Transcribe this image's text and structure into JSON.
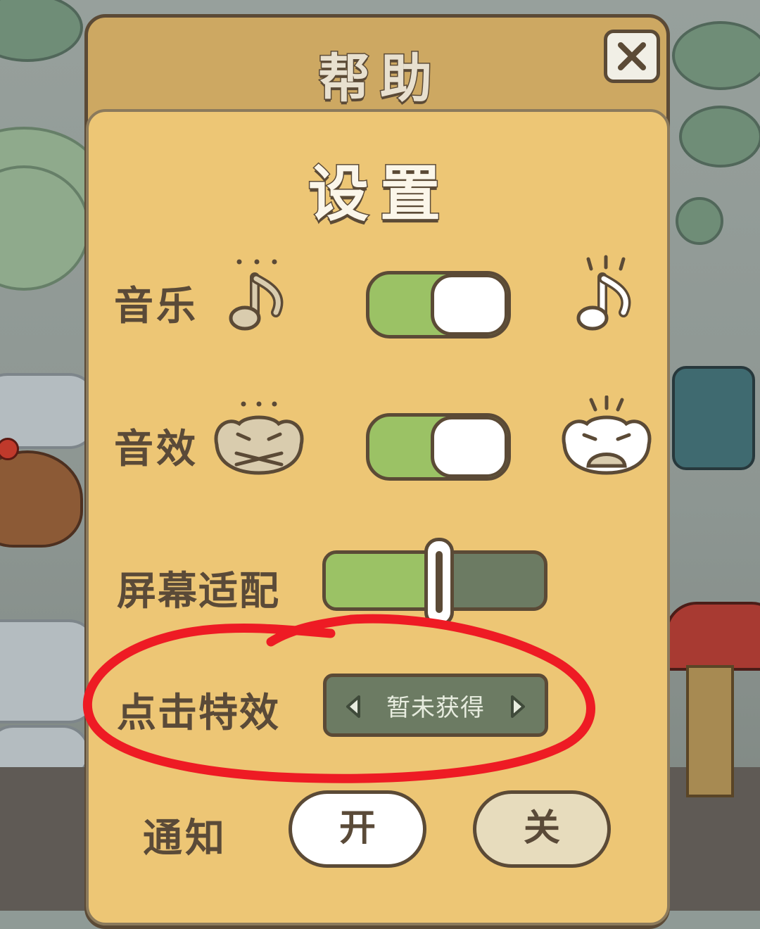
{
  "dialog": {
    "header_title": "帮助",
    "close_icon": "close-icon",
    "section_title": "设置"
  },
  "settings": {
    "music": {
      "label": "音乐",
      "icon_left": "music-note-muted-icon",
      "icon_right": "music-note-loud-icon",
      "enabled": true
    },
    "sound_effects": {
      "label": "音效",
      "icon_left": "frog-muted-icon",
      "icon_right": "frog-loud-icon",
      "enabled": true
    },
    "screen_fit": {
      "label": "屏幕适配",
      "level": 0.52
    },
    "tap_effect": {
      "label": "点击特效",
      "value": "暂未获得",
      "prev_icon": "arrow-left-icon",
      "next_icon": "arrow-right-icon"
    },
    "notifications": {
      "label": "通知",
      "on_label": "开",
      "off_label": "关",
      "selected": "on"
    }
  },
  "colors": {
    "panel": "#edc675",
    "header": "#cda862",
    "outline": "#5b4a36",
    "toggle_on": "#9bc265",
    "slider_track": "#6c7b63",
    "annotation": "#ee1b24"
  }
}
